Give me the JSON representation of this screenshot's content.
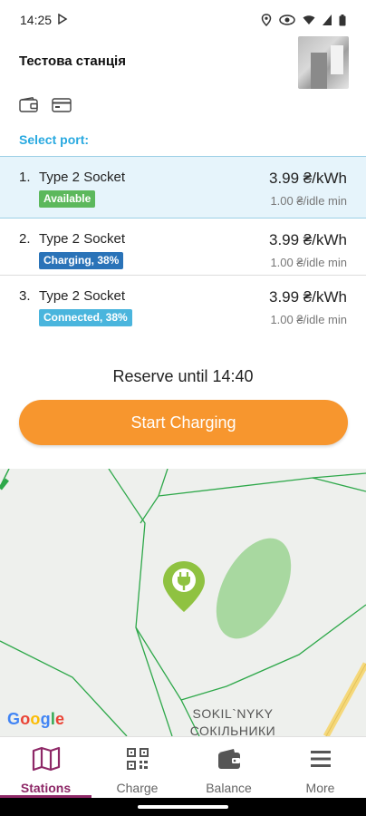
{
  "status_bar": {
    "time": "14:25",
    "icons": [
      "play-store-icon",
      "location-icon",
      "eye-icon",
      "wifi-icon",
      "signal-icon",
      "battery-icon"
    ]
  },
  "station": {
    "name": "Тестова станція",
    "payment_icons": [
      "wallet-icon",
      "credit-card-icon"
    ]
  },
  "select_port_label": "Select port:",
  "ports": [
    {
      "num": "1.",
      "type": "Type 2 Socket",
      "status": "Available",
      "status_color": "#5cb85c",
      "price": "3.99 ₴/kWh",
      "idle": "1.00 ₴/idle min",
      "selected": true
    },
    {
      "num": "2.",
      "type": "Type 2 Socket",
      "status": "Charging, 38%",
      "status_color": "#2a73b8",
      "price": "3.99 ₴/kWh",
      "idle": "1.00 ₴/idle min",
      "selected": false
    },
    {
      "num": "3.",
      "type": "Type 2 Socket",
      "status": "Connected, 38%",
      "status_color": "#4ab5dd",
      "price": "3.99 ₴/kWh",
      "idle": "1.00 ₴/idle min",
      "selected": false
    }
  ],
  "reserve_text": "Reserve until 14:40",
  "start_button": "Start Charging",
  "map": {
    "google_logo": "Google",
    "district_latin": "SOKIL`NYKY",
    "district_cyrillic": "СОКІЛЬНИКИ",
    "marker": "charging-station-marker-icon"
  },
  "nav": [
    {
      "label": "Stations",
      "icon": "map-icon",
      "active": true
    },
    {
      "label": "Charge",
      "icon": "qr-code-icon",
      "active": false
    },
    {
      "label": "Balance",
      "icon": "wallet-icon",
      "active": false
    },
    {
      "label": "More",
      "icon": "menu-icon",
      "active": false
    }
  ],
  "colors": {
    "accent": "#29a9e0",
    "button": "#f7962e",
    "nav_active": "#8e2867",
    "available": "#5cb85c",
    "charging": "#2a73b8",
    "connected": "#4ab5dd"
  }
}
